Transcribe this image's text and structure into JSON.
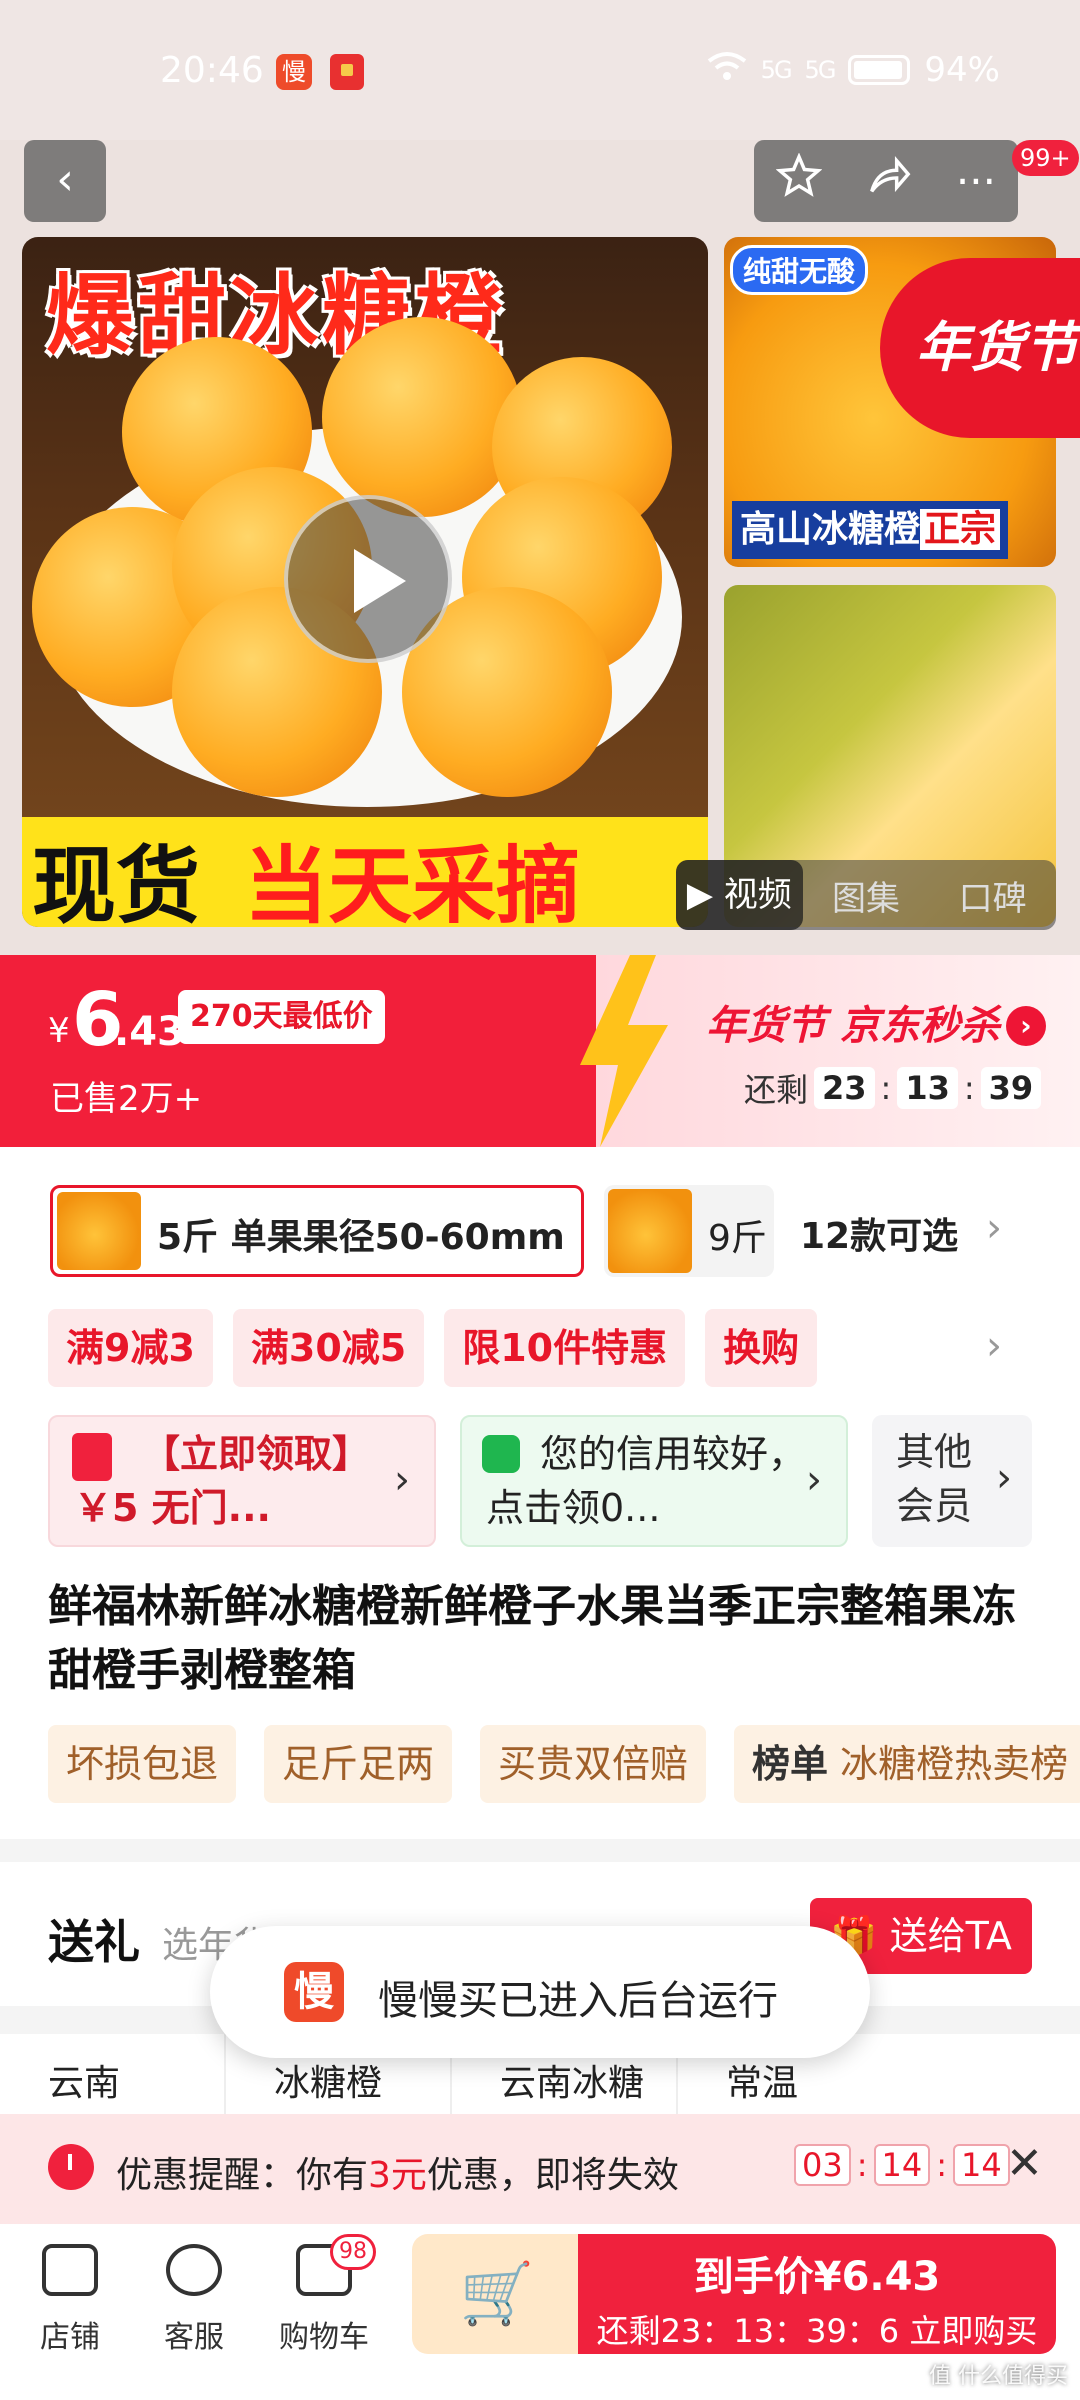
{
  "status_bar": {
    "time": "20:46",
    "app_icon_1": "慢",
    "signal1": "5G",
    "signal2": "5G",
    "battery": "94%"
  },
  "nav": {
    "badge": "99+",
    "icons": [
      "back-icon",
      "star-icon",
      "share-icon",
      "more-icon"
    ]
  },
  "gallery": {
    "main_title": "爆甜冰糖橙",
    "banner_left": "现货",
    "banner_right": "当天采摘",
    "side1_tag": "纯甜无酸",
    "side1_caption": "高山冰糖橙",
    "side1_caption_hl": "正宗",
    "corner_badge": "年货节",
    "tabs": [
      "▶ 视频",
      "图集",
      "口碑"
    ]
  },
  "price": {
    "currency": "¥",
    "integer": "6",
    "decimal": ".43",
    "low_badge": "270天最低价",
    "sold": "已售2万+",
    "seckill": "年货节 京东秒杀",
    "countdown_label": "还剩",
    "countdown": [
      "23",
      "13",
      "39"
    ],
    "colors": {
      "accent": "#f21f3a"
    }
  },
  "spec": {
    "selected": "5斤 单果果径50-60mm",
    "option2": "9斤",
    "count": "12款可选"
  },
  "promos": [
    "满9减3",
    "满30减5",
    "限10件特惠",
    "换购"
  ],
  "coupons": {
    "c1": "【立即领取】￥5 无门...",
    "c2": "您的信用较好，点击领0...",
    "c3": "其他会员"
  },
  "product_title": "鲜福林新鲜冰糖橙新鲜橙子水果当季正宗整箱果冻甜橙手剥橙整箱",
  "features": [
    {
      "bold": "",
      "text": "坏损包退"
    },
    {
      "bold": "",
      "text": "足斤足两"
    },
    {
      "bold": "",
      "text": "买贵双倍赔"
    },
    {
      "bold": "榜单",
      "text": " 冰糖橙热卖榜"
    }
  ],
  "gift": {
    "label": "送礼",
    "sub": "选年货 送亲朋 好友写地址",
    "button": "送给TA"
  },
  "toast": {
    "icon": "慢",
    "text": "慢慢买已进入后台运行"
  },
  "attrs": [
    "云南",
    "冰糖橙",
    "云南冰糖橙",
    "常温"
  ],
  "reminder": {
    "prefix": "优惠提醒：你有",
    "highlight": "3元",
    "suffix": "优惠，即将失效",
    "countdown": [
      "03",
      "14",
      "14"
    ],
    "close": "✕"
  },
  "bottom": {
    "shop": "店铺",
    "service": "客服",
    "cart": "购物车",
    "cart_badge": "98",
    "buy_main": "到手价¥6.43",
    "buy_sub": "还剩23：13：39：6 立即购买"
  },
  "watermark": "值 什么值得买"
}
